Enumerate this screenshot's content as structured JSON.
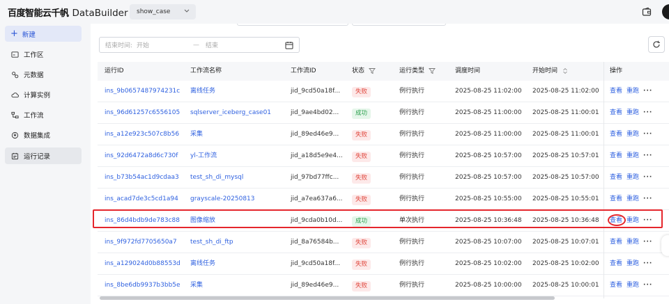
{
  "header": {
    "logo_cn": "百度智能云千帆",
    "logo_en": "DataBuilder",
    "workspace": "show_case"
  },
  "sidebar": {
    "new_label": "新建",
    "items": [
      {
        "label": "工作区",
        "icon": "folder-icon"
      },
      {
        "label": "元数据",
        "icon": "metadata-icon"
      },
      {
        "label": "计算实例",
        "icon": "cloud-icon"
      },
      {
        "label": "工作流",
        "icon": "workflow-icon"
      },
      {
        "label": "数据集成",
        "icon": "integration-icon"
      },
      {
        "label": "运行记录",
        "icon": "run-record-icon",
        "active": true
      }
    ]
  },
  "filters": {
    "time_label": "结束时间:",
    "start_placeholder": "开始",
    "separator": "—",
    "end_placeholder": "结束"
  },
  "table": {
    "columns": [
      "运行ID",
      "工作流名称",
      "工作流ID",
      "状态",
      "运行类型",
      "调度时间",
      "开始时间",
      "操作"
    ],
    "rows": [
      {
        "run_id": "ins_9b0657487974231c",
        "name": "离线任务",
        "flow_id": "jid_9cd50a18f...",
        "status": "失败",
        "status_type": "fail",
        "run_type": "例行执行",
        "sched": "2025-08-25 11:02:00",
        "start": "2025-08-25 11:02:00"
      },
      {
        "run_id": "ins_96d61257c6556105",
        "name": "sqlserver_iceberg_case01",
        "flow_id": "jid_9ae4bd02...",
        "status": "成功",
        "status_type": "succ",
        "run_type": "例行执行",
        "sched": "2025-08-25 11:00:00",
        "start": "2025-08-25 11:00:01"
      },
      {
        "run_id": "ins_a12e923c507c8b56",
        "name": "采集",
        "flow_id": "jid_89ed46e9...",
        "status": "失败",
        "status_type": "fail",
        "run_type": "例行执行",
        "sched": "2025-08-25 11:00:00",
        "start": "2025-08-25 11:00:01"
      },
      {
        "run_id": "ins_92d6472a8d6c730f",
        "name": "yl-工作流",
        "flow_id": "jid_a18d5e9e4...",
        "status": "失败",
        "status_type": "fail",
        "run_type": "例行执行",
        "sched": "2025-08-25 10:57:00",
        "start": "2025-08-25 10:57:01"
      },
      {
        "run_id": "ins_b73b54ac1d9cdaa3",
        "name": "test_sh_di_mysql",
        "flow_id": "jid_97bd77ffc...",
        "status": "失败",
        "status_type": "fail",
        "run_type": "例行执行",
        "sched": "2025-08-25 10:57:00",
        "start": "2025-08-25 10:57:00"
      },
      {
        "run_id": "ins_acad7de3c5cd1a94",
        "name": "grayscale-20250813",
        "flow_id": "jid_a7ea637a6...",
        "status": "失败",
        "status_type": "fail",
        "run_type": "例行执行",
        "sched": "2025-08-25 10:55:00",
        "start": "2025-08-25 10:55:01"
      },
      {
        "run_id": "ins_86d4bdb9de783c88",
        "name": "图像缩放",
        "flow_id": "jid_9cda0b10d...",
        "status": "成功",
        "status_type": "succ",
        "run_type": "单次执行",
        "sched": "2025-08-25 10:36:48",
        "start": "2025-08-25 10:36:48"
      },
      {
        "run_id": "ins_9f972fd7705650a7",
        "name": "test_sh_di_ftp",
        "flow_id": "jid_8a76584b...",
        "status": "失败",
        "status_type": "fail",
        "run_type": "例行执行",
        "sched": "2025-08-25 10:07:00",
        "start": "2025-08-25 10:07:01"
      },
      {
        "run_id": "ins_a129024d0b88553d",
        "name": "离线任务",
        "flow_id": "jid_9cd50a18f...",
        "status": "失败",
        "status_type": "fail",
        "run_type": "例行执行",
        "sched": "2025-08-25 10:02:00",
        "start": "2025-08-25 10:02:00"
      },
      {
        "run_id": "ins_8be6db9937b3bb5e",
        "name": "采集",
        "flow_id": "jid_89ed46e9...",
        "status": "失败",
        "status_type": "fail",
        "run_type": "例行执行",
        "sched": "2025-08-25 10:00:00",
        "start": "2025-08-25 10:00:01"
      }
    ],
    "actions": {
      "view": "查看",
      "rerun": "重跑",
      "more": "···"
    }
  },
  "colors": {
    "accent": "#2f61e0",
    "fail": "#e0473d",
    "success": "#2ea14f",
    "highlight": "#e5262c"
  }
}
